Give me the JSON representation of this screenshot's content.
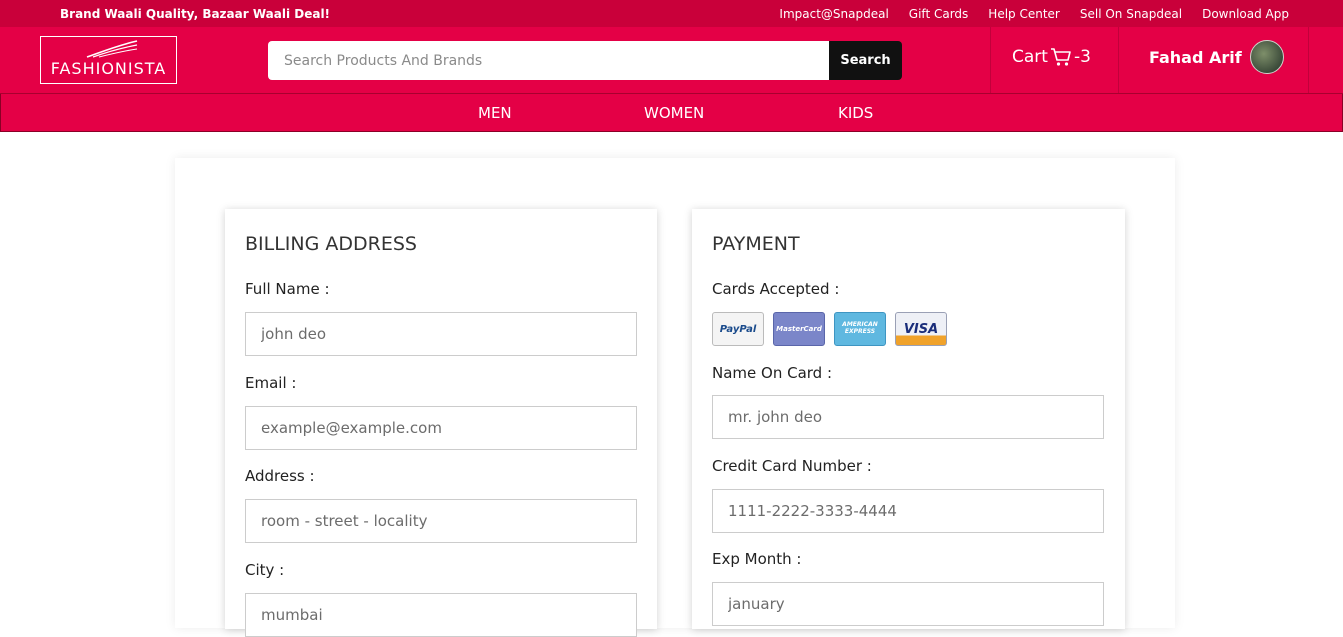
{
  "topbar": {
    "tagline": "Brand Waali Quality, Bazaar Waali Deal!",
    "links": [
      "Impact@Snapdeal",
      "Gift Cards",
      "Help Center",
      "Sell On Snapdeal",
      "Download App"
    ]
  },
  "header": {
    "logo_text": "FASHIONISTA",
    "search_placeholder": "Search Products And Brands",
    "search_button": "Search",
    "cart_label": "Cart",
    "cart_count": "-3",
    "user_name": "Fahad Arif"
  },
  "nav": {
    "items": [
      "MEN",
      "WOMEN",
      "KIDS"
    ]
  },
  "billing": {
    "title": "BILLING ADDRESS",
    "fields": [
      {
        "label": "Full Name :",
        "placeholder": "john deo"
      },
      {
        "label": "Email :",
        "placeholder": "example@example.com"
      },
      {
        "label": "Address :",
        "placeholder": "room - street - locality"
      },
      {
        "label": "City :",
        "placeholder": "mumbai"
      }
    ]
  },
  "payment": {
    "title": "PAYMENT",
    "cards_label": "Cards Accepted :",
    "cards": [
      "PayPal",
      "MasterCard",
      "AMERICAN EXPRESS",
      "VISA"
    ],
    "fields": [
      {
        "label": "Name On Card :",
        "placeholder": "mr. john deo"
      },
      {
        "label": "Credit Card Number :",
        "placeholder": "1111-2222-3333-4444"
      },
      {
        "label": "Exp Month :",
        "placeholder": "january"
      }
    ]
  },
  "colors": {
    "brand": "#e40046",
    "topbar": "#c9003a",
    "dark_button": "#111111"
  }
}
